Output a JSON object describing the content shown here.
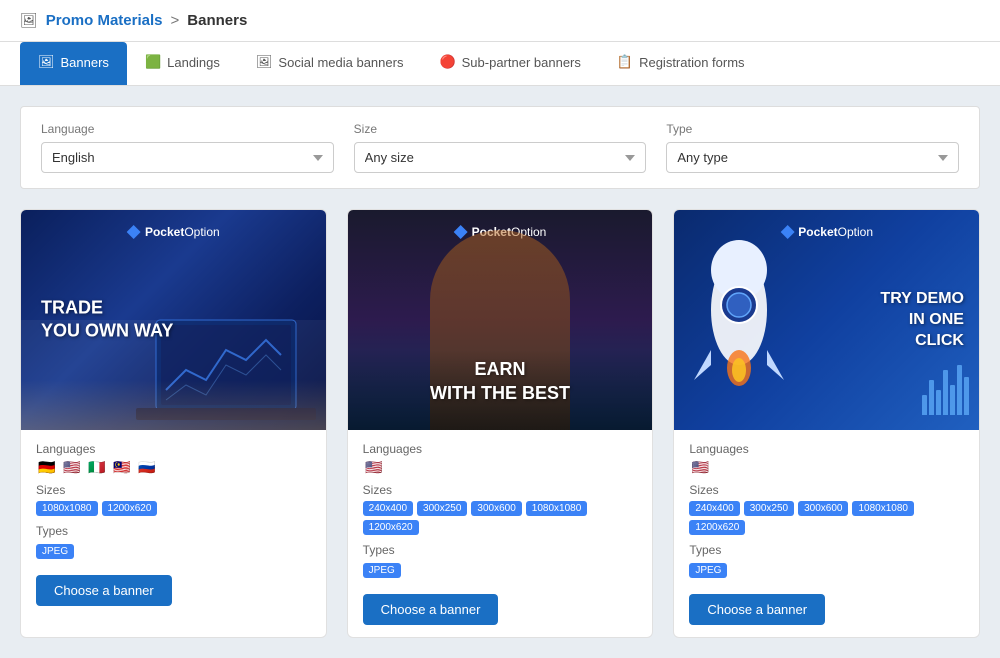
{
  "breadcrumb": {
    "icon": "🖼",
    "parent": "Promo Materials",
    "separator": ">",
    "current": "Banners"
  },
  "tabs": [
    {
      "id": "banners",
      "label": "Banners",
      "icon": "🖼",
      "active": true
    },
    {
      "id": "landings",
      "label": "Landings",
      "icon": "🟩",
      "active": false
    },
    {
      "id": "social-media-banners",
      "label": "Social media banners",
      "icon": "🖼",
      "active": false
    },
    {
      "id": "sub-partner-banners",
      "label": "Sub-partner banners",
      "icon": "🔴",
      "active": false
    },
    {
      "id": "registration-forms",
      "label": "Registration forms",
      "icon": "📋",
      "active": false
    }
  ],
  "filters": {
    "language": {
      "label": "Language",
      "value": "English",
      "placeholder": "English"
    },
    "size": {
      "label": "Size",
      "value": "Any size",
      "placeholder": "Any size"
    },
    "type": {
      "label": "Type",
      "value": "Any type",
      "placeholder": "Any type"
    }
  },
  "banners": [
    {
      "id": 1,
      "tagline": "TRADE\nYOU OWN WAY",
      "logo": "PocketOption",
      "languages_label": "Languages",
      "sizes_label": "Sizes",
      "types_label": "Types",
      "flags": [
        "🇩🇪",
        "🇺🇸",
        "🇮🇹",
        "🇲🇾",
        "🇷🇺"
      ],
      "sizes": [
        "1080x1080",
        "1200x620"
      ],
      "type": "JPEG",
      "button_label": "Choose a banner"
    },
    {
      "id": 2,
      "tagline": "EARN\nWITH THE BEST",
      "logo": "PocketOption",
      "languages_label": "Languages",
      "sizes_label": "Sizes",
      "types_label": "Types",
      "flags": [
        "🇺🇸"
      ],
      "sizes": [
        "240x400",
        "300x250",
        "300x600",
        "1080x1080",
        "1200x620"
      ],
      "type": "JPEG",
      "button_label": "Choose a banner"
    },
    {
      "id": 3,
      "tagline": "TRY DEMO\nIN ONE\nCLICK",
      "logo": "PocketOption",
      "languages_label": "Languages",
      "sizes_label": "Sizes",
      "types_label": "Types",
      "flags": [
        "🇺🇸"
      ],
      "sizes": [
        "240x400",
        "300x250",
        "300x600",
        "1080x1080",
        "1200x620"
      ],
      "type": "JPEG",
      "button_label": "Choose a banner"
    }
  ]
}
